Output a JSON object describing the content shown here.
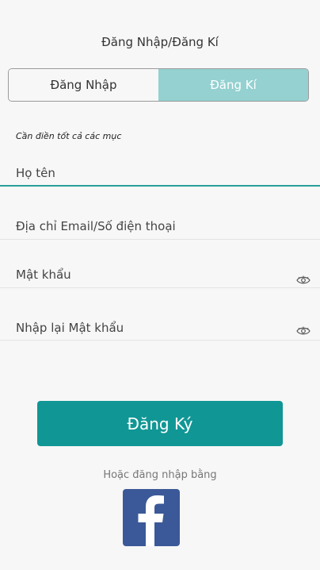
{
  "header": {
    "title": "Đăng Nhập/Đăng Kí"
  },
  "tabs": [
    {
      "label": "Đăng Nhập",
      "active": false
    },
    {
      "label": "Đăng Kí",
      "active": true
    }
  ],
  "form": {
    "note": "Cần điền tốt cả các mục",
    "fields": {
      "full_name": {
        "placeholder": "Họ tên",
        "value": ""
      },
      "email_phone": {
        "placeholder": "Địa chỉ Email/Số điện thoại",
        "value": ""
      },
      "password": {
        "placeholder": "Mật khẩu",
        "value": ""
      },
      "confirm_password": {
        "placeholder": "Nhập lại Mật khẩu",
        "value": ""
      }
    },
    "submit_label": "Đăng Ký"
  },
  "social": {
    "label": "Hoặc đăng nhập bằng",
    "icon": "facebook-icon"
  },
  "colors": {
    "accent": "#109795",
    "tab_active": "#94d1d0",
    "focus_line": "#2a9f9a",
    "facebook": "#3b5998"
  }
}
